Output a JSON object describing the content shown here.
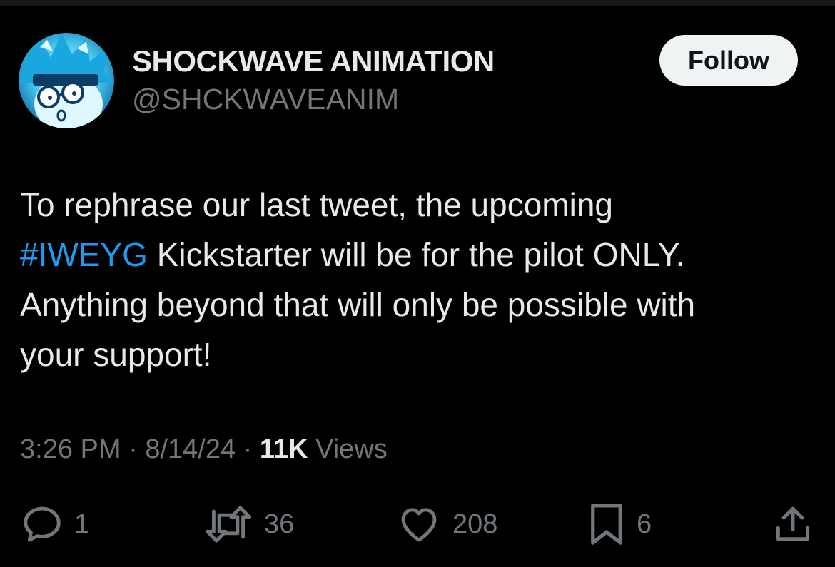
{
  "user": {
    "display_name": "SHOCKWAVE ANIMATION",
    "handle": "@SHCKWAVEANIM",
    "follow_label": "Follow",
    "avatar_icon": "cartoon-character-avatar"
  },
  "tweet": {
    "lines": [
      {
        "before": "To rephrase our last tweet, the upcoming",
        "hashtag": "",
        "after": ""
      },
      {
        "before": "",
        "hashtag": "#IWEYG",
        "after": " Kickstarter will be for the pilot ONLY."
      },
      {
        "before": "Anything beyond that will only be possible with",
        "hashtag": "",
        "after": ""
      },
      {
        "before": "your support!",
        "hashtag": "",
        "after": ""
      }
    ]
  },
  "meta": {
    "time": "3:26 PM",
    "separator": "·",
    "date": "8/14/24",
    "views_count": "11K",
    "views_label": "Views"
  },
  "actions": {
    "reply": {
      "icon": "reply-icon",
      "count": "1"
    },
    "retweet": {
      "icon": "retweet-icon",
      "count": "36"
    },
    "like": {
      "icon": "heart-icon",
      "count": "208"
    },
    "bookmark": {
      "icon": "bookmark-icon",
      "count": "6"
    },
    "share": {
      "icon": "share-icon"
    }
  },
  "colors": {
    "background": "#000000",
    "text_primary": "#e7e9ea",
    "text_secondary": "#71767b",
    "hashtag": "#1d9bf0",
    "follow_button_bg": "#eff3f4"
  }
}
